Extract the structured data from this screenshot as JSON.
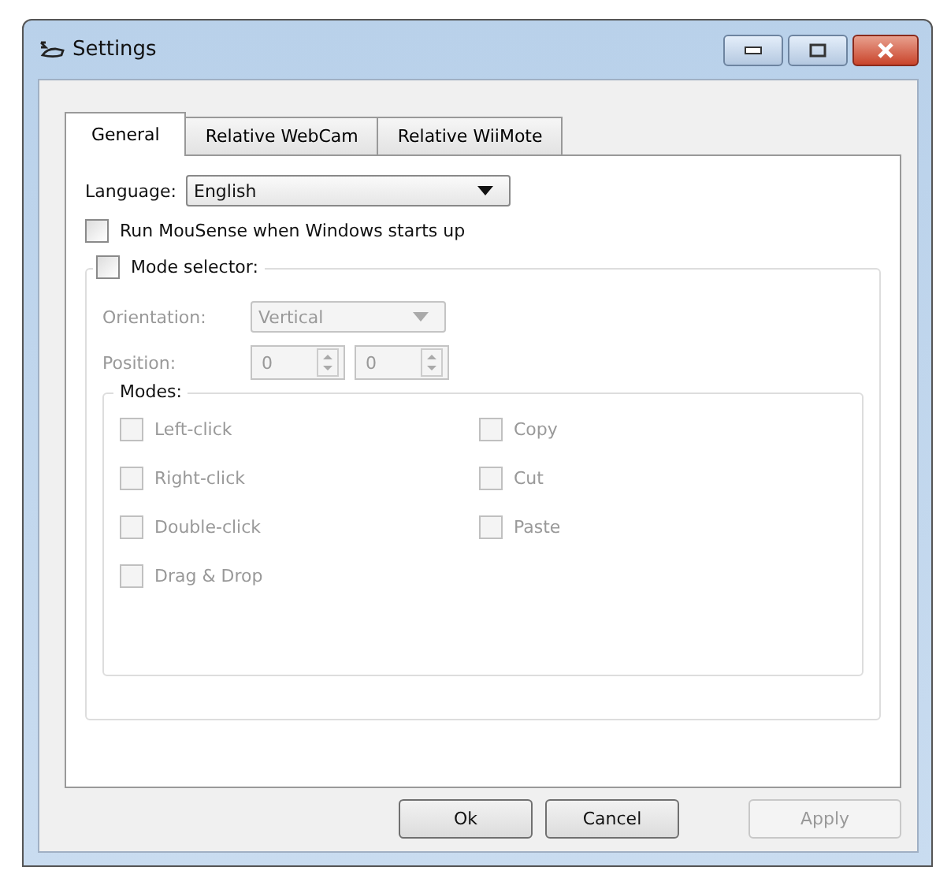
{
  "window": {
    "title": "Settings"
  },
  "tabs": [
    {
      "label": "General",
      "selected": true
    },
    {
      "label": "Relative WebCam",
      "selected": false
    },
    {
      "label": "Relative WiiMote",
      "selected": false
    }
  ],
  "language": {
    "label": "Language:",
    "value": "English"
  },
  "run_at_startup": {
    "label": "Run MouSense when Windows starts up",
    "checked": false
  },
  "mode_selector": {
    "label": "Mode selector:",
    "checked": false,
    "disabled": true,
    "orientation": {
      "label": "Orientation:",
      "value": "Vertical"
    },
    "position": {
      "label": "Position:",
      "values": [
        "0",
        "0"
      ]
    },
    "modes": {
      "label": "Modes:",
      "columns": [
        [
          {
            "label": "Left-click",
            "checked": false
          },
          {
            "label": "Right-click",
            "checked": false
          },
          {
            "label": "Double-click",
            "checked": false
          },
          {
            "label": "Drag & Drop",
            "checked": false
          }
        ],
        [
          {
            "label": "Copy",
            "checked": false
          },
          {
            "label": "Cut",
            "checked": false
          },
          {
            "label": "Paste",
            "checked": false
          }
        ]
      ]
    }
  },
  "buttons": [
    {
      "label": "Ok",
      "disabled": false
    },
    {
      "label": "Cancel",
      "disabled": false
    },
    {
      "label": "Apply",
      "disabled": true
    }
  ]
}
